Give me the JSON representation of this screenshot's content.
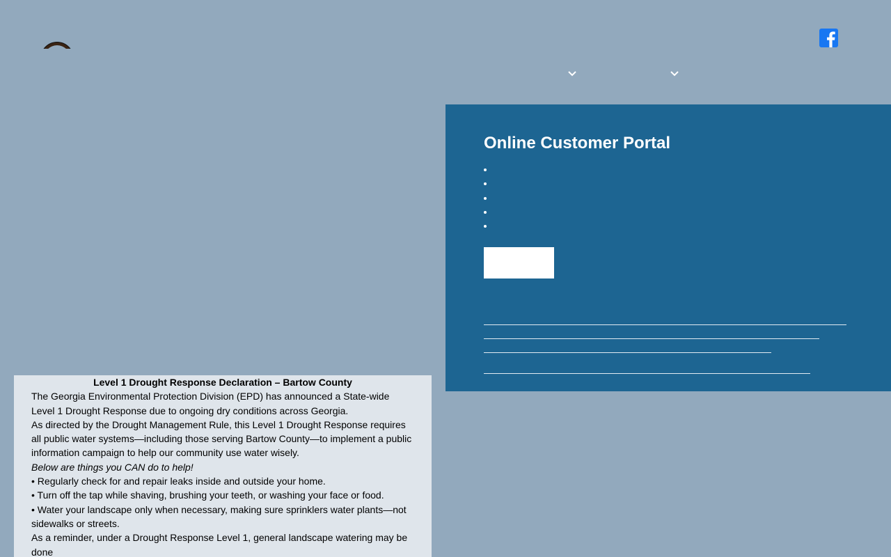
{
  "header": {
    "logo": {
      "icon": "county-seal-icon"
    },
    "social": {
      "icon": "facebook-icon",
      "color": "#1877f2"
    },
    "nav": [
      {
        "icon": "chevron-down-icon"
      },
      {
        "icon": "chevron-down-icon"
      }
    ]
  },
  "portal": {
    "title": "Online Customer Portal",
    "background": "#1d6592",
    "list_item_count": 5
  },
  "notice": {
    "title": "Level 1 Drought Response Declaration – Bartow County",
    "paragraphs": [
      "The Georgia Environmental Protection Division (EPD) has announced a State-wide Level 1 Drought Response due to ongoing dry conditions across Georgia.",
      "As directed by the Drought Management Rule, this Level 1 Drought Response requires all public water systems—including those serving Bartow County—to implement a public information campaign to help our community use water wisely.",
      "Below are things you CAN do to help!",
      "• Regularly check for and repair leaks inside and outside your home.",
      "• Turn off the tap while shaving, brushing your teeth, or washing your face or food.",
      "• Water your landscape only when necessary, making sure sprinklers water plants—not sidewalks or streets.",
      "As a reminder, under a Drought Response Level 1, general landscape watering may be done"
    ]
  }
}
